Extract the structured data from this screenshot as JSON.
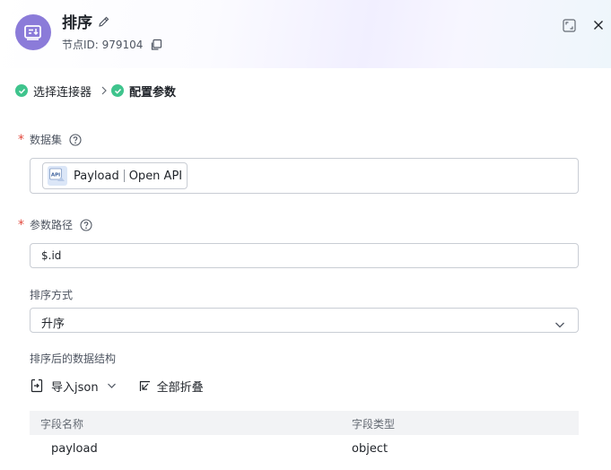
{
  "header": {
    "title": "排序",
    "node_id_label": "节点ID: 979104",
    "node_icon": "sort-node-icon",
    "icons": [
      "edit-icon",
      "copy-icon",
      "fullscreen-icon",
      "close-icon"
    ]
  },
  "steps": [
    {
      "label": "选择连接器",
      "status": "done"
    },
    {
      "label": "配置参数",
      "status": "done-active"
    }
  ],
  "form": {
    "dataset": {
      "label": "数据集",
      "required": true,
      "chip_name": "Payload",
      "chip_type": "Open API",
      "chip_icon": "api-icon"
    },
    "param_path": {
      "label": "参数路径",
      "required": true,
      "value": "$.id"
    },
    "sort_order": {
      "label": "排序方式",
      "value": "升序"
    },
    "structure": {
      "label": "排序后的数据结构",
      "import_label": "导入json",
      "collapse_label": "全部折叠",
      "columns": [
        "字段名称",
        "字段类型"
      ],
      "rows": [
        {
          "name": "payload",
          "type": "object"
        }
      ]
    }
  },
  "colors": {
    "accent": "#8b7bd9",
    "success": "#3fc48d",
    "required": "#e2483d",
    "border": "#c9cdd4"
  }
}
